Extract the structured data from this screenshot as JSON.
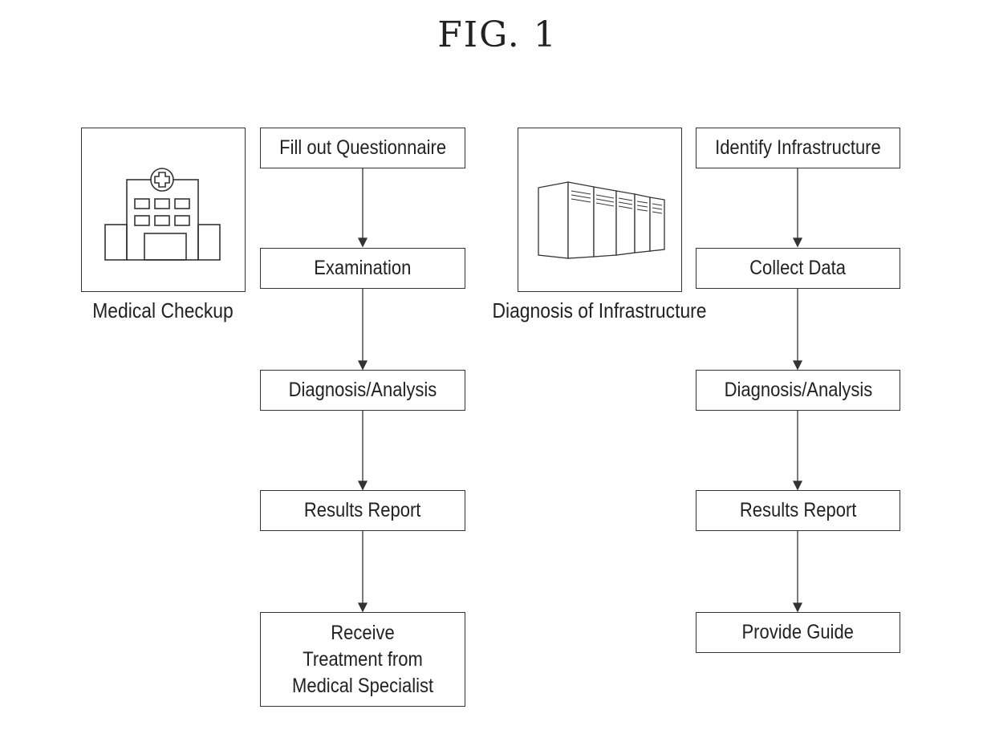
{
  "figure": {
    "title": "FIG. 1"
  },
  "left_panel": {
    "icon": "hospital-icon",
    "caption": "Medical Checkup",
    "steps": [
      "Fill out Questionnaire",
      "Examination",
      "Diagnosis/Analysis",
      "Results Report",
      "Receive\nTreatment from\nMedical Specialist"
    ]
  },
  "right_panel": {
    "icon": "server-racks-icon",
    "caption": "Diagnosis of Infrastructure",
    "steps": [
      "Identify Infrastructure",
      "Collect Data",
      "Diagnosis/Analysis",
      "Results Report",
      "Provide Guide"
    ]
  },
  "colors": {
    "line": "#333333",
    "text": "#222222",
    "background": "#ffffff"
  }
}
